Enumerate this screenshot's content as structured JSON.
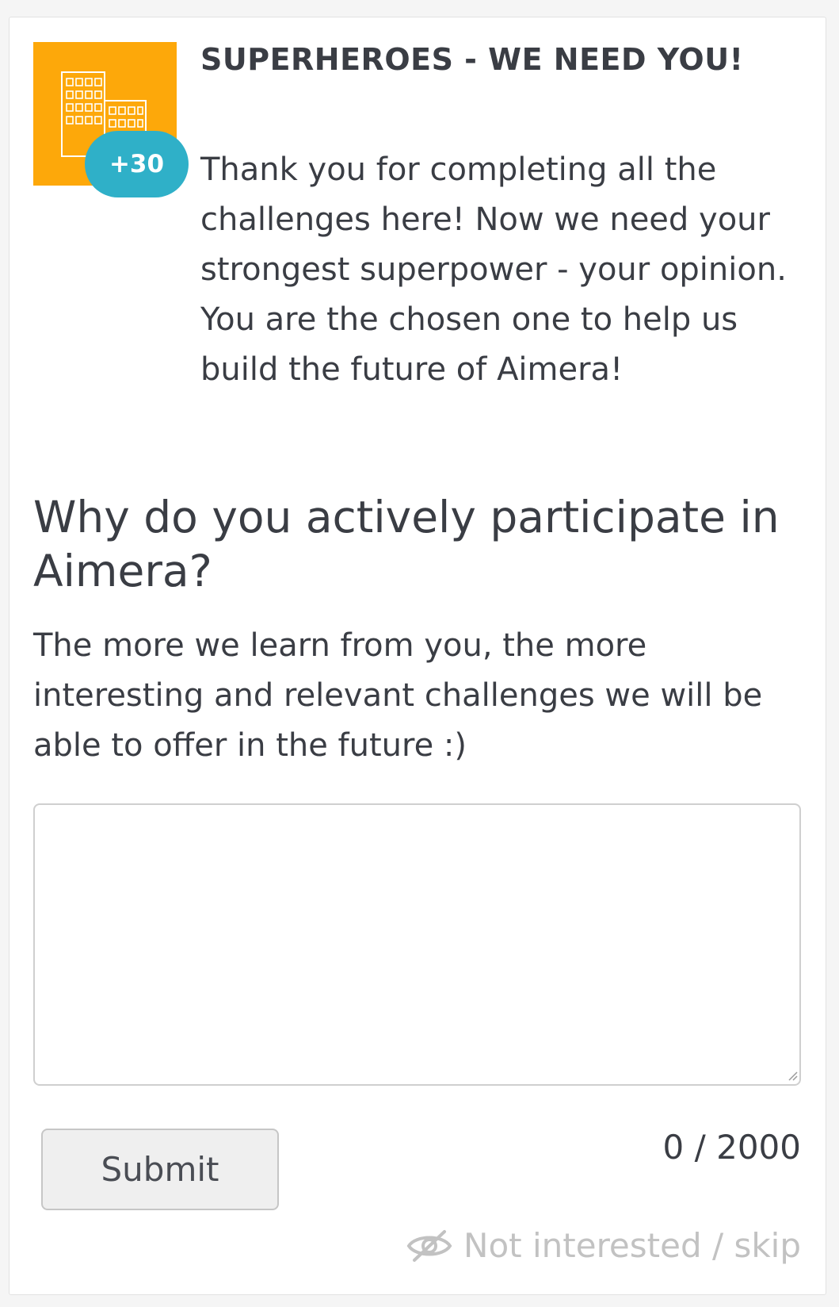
{
  "challenge": {
    "image_icon": "buildings-icon",
    "image_color": "#fda80a",
    "points_badge": "+30",
    "points_color": "#2fb0c8",
    "title": "SUPERHEROES - WE NEED YOU!",
    "intro": "Thank you for completing all the challenges here! Now we need your strongest superpower - your opinion. You are the chosen one to help us build the future of Aimera!"
  },
  "question": {
    "text": "Why do you actively participate in Aimera?",
    "help": "The more we learn from you, the more interesting and relevant challenges we will be able to offer in the future :)"
  },
  "answer": {
    "value": "",
    "placeholder": "",
    "counter": "0 / 2000"
  },
  "actions": {
    "submit_label": "Submit",
    "skip_icon": "eye-slash-icon",
    "skip_label": "Not interested / skip"
  }
}
